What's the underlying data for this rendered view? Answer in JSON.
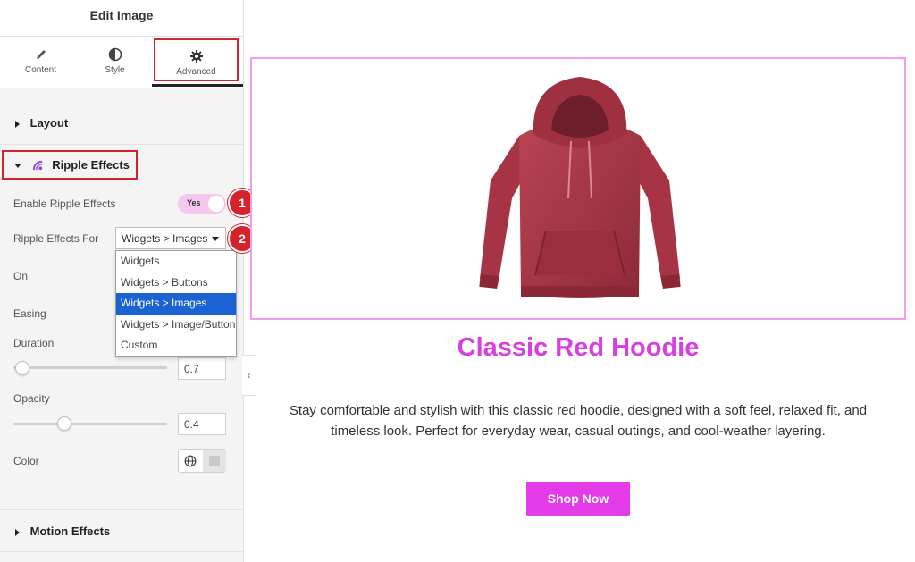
{
  "panel": {
    "title": "Edit Image",
    "tabs": [
      {
        "label": "Content",
        "icon": "pencil-icon"
      },
      {
        "label": "Style",
        "icon": "contrast-icon"
      },
      {
        "label": "Advanced",
        "icon": "gear-icon"
      }
    ],
    "active_tab": "Advanced",
    "sections": {
      "layout": "Layout",
      "ripple": "Ripple Effects",
      "motion": "Motion Effects"
    },
    "controls": {
      "enable_label": "Enable Ripple Effects",
      "enable_value": "Yes",
      "for_label": "Ripple Effects For",
      "for_value": "Widgets > Images",
      "for_options": [
        "Widgets",
        "Widgets > Buttons",
        "Widgets > Images",
        "Widgets > Image/Button",
        "Custom"
      ],
      "on_label": "On",
      "easing_label": "Easing",
      "duration_label": "Duration",
      "duration_value": "0.7",
      "opacity_label": "Opacity",
      "opacity_value": "0.4",
      "color_label": "Color"
    },
    "badges": [
      "1",
      "2"
    ]
  },
  "preview": {
    "product_title": "Classic Red Hoodie",
    "description": "Stay comfortable and stylish with this classic red hoodie, designed with a soft feel, relaxed fit, and timeless look. Perfect for everyday wear, casual outings, and cool-weather layering.",
    "button_label": "Shop Now"
  },
  "colors": {
    "accent": "#d83fe1",
    "button": "#e33be8",
    "highlight": "#d4232b",
    "selected_option": "#1b62d2"
  }
}
